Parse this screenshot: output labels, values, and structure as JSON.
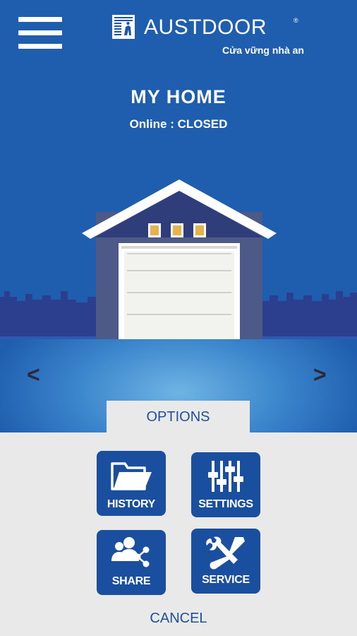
{
  "header": {
    "brand": "AUSTDOOR",
    "registered_mark": "®",
    "tagline": "Cửa vững nhà an",
    "menu_icon": "hamburger-menu-icon"
  },
  "home": {
    "name": "MY HOME",
    "status": "Online : CLOSED"
  },
  "navigation": {
    "prev": "<",
    "next": ">"
  },
  "options": {
    "tab_label": "OPTIONS",
    "buttons": [
      {
        "label": "HISTORY",
        "icon": "folder-icon"
      },
      {
        "label": "SETTINGS",
        "icon": "sliders-icon"
      },
      {
        "label": "SHARE",
        "icon": "share-users-icon"
      },
      {
        "label": "SERVICE",
        "icon": "tools-icon"
      }
    ],
    "cancel_label": "CANCEL"
  },
  "colors": {
    "brand_blue": "#1a4fa0",
    "sky_blue": "#2a6dbe",
    "panel_gray": "#e9e9e9"
  }
}
